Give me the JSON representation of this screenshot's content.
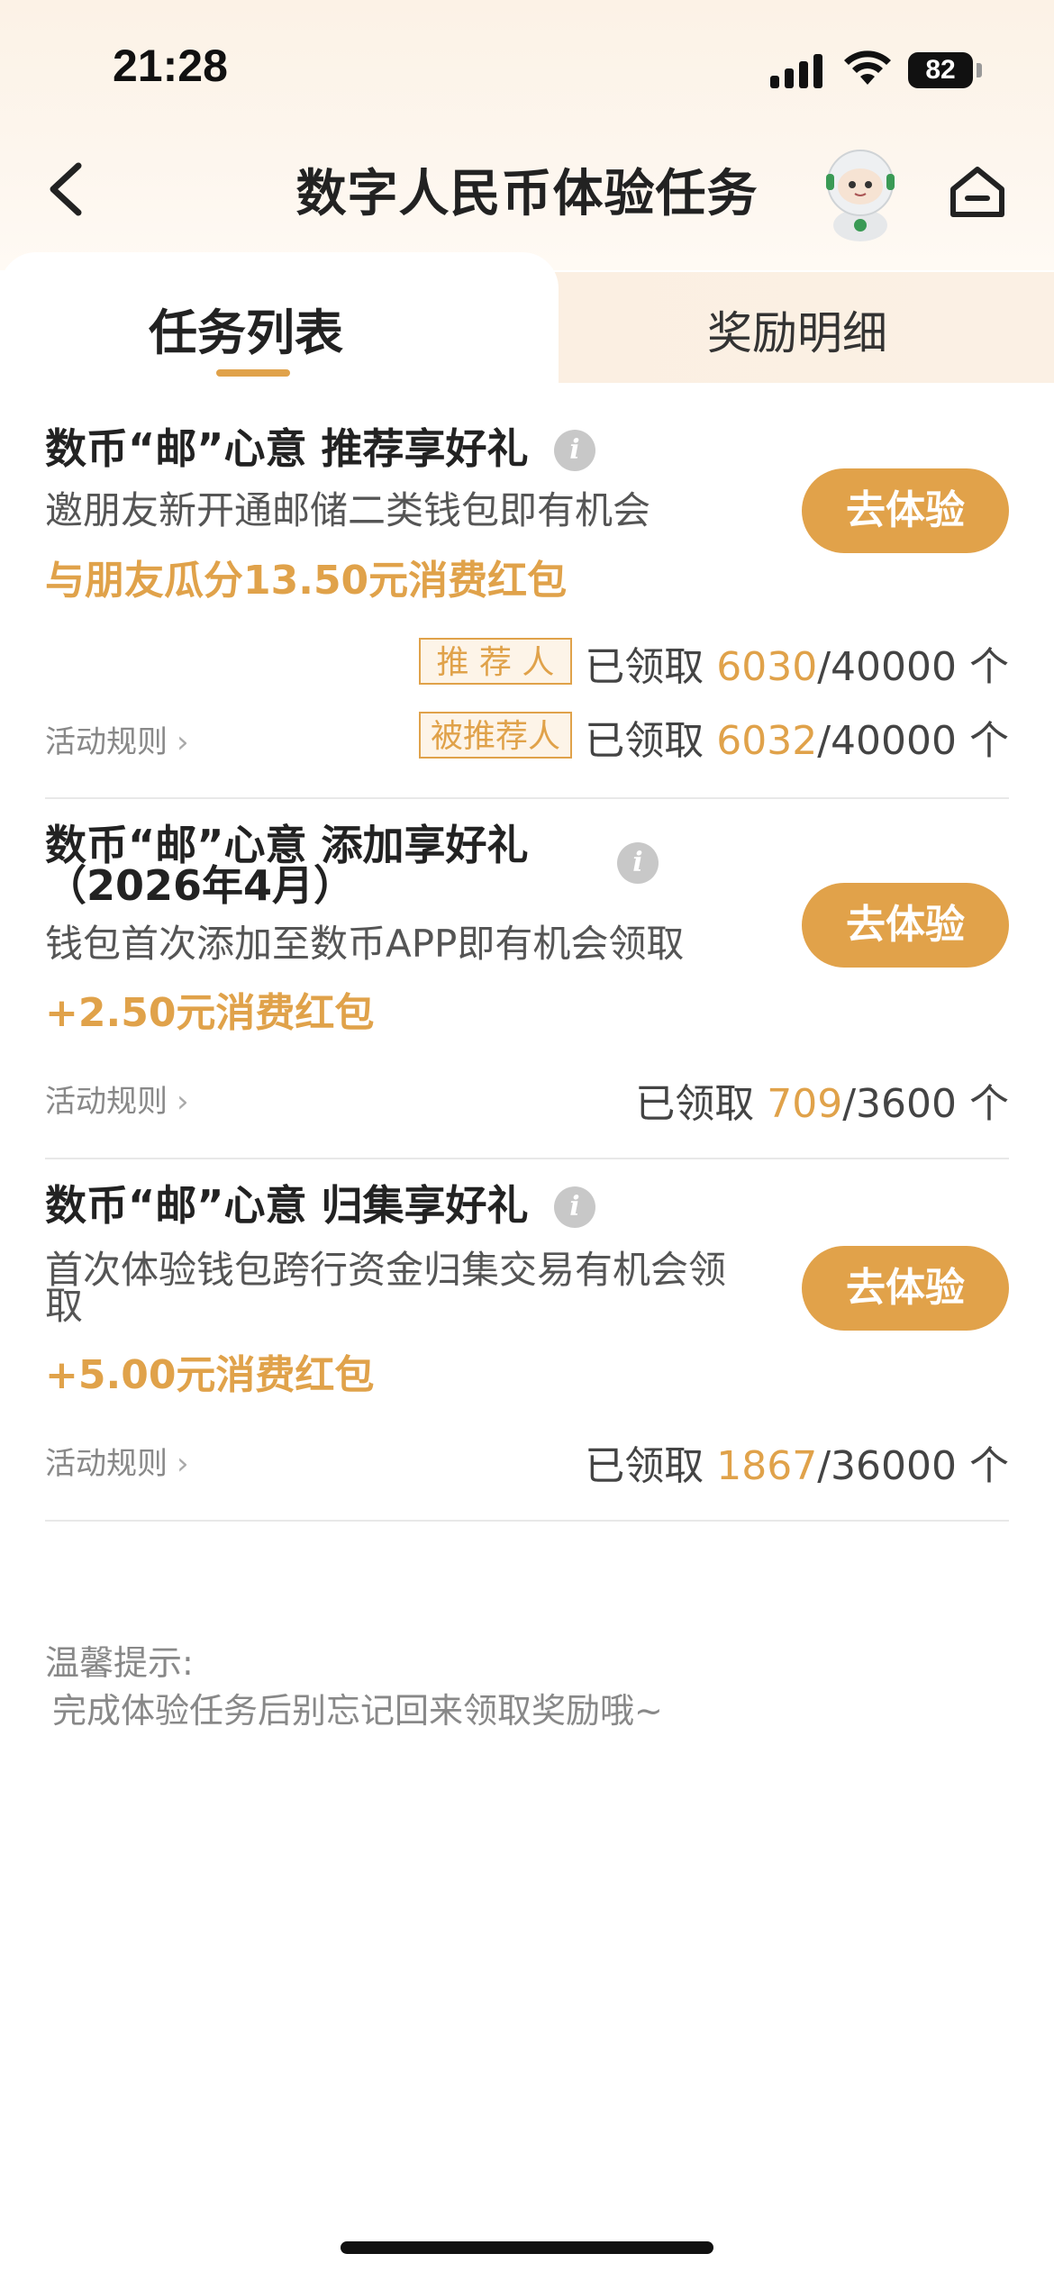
{
  "status_bar": {
    "time": "21:28",
    "battery": "82"
  },
  "nav": {
    "title": "数字人民币体验任务"
  },
  "tabs": [
    {
      "label": "任务列表",
      "active": true
    },
    {
      "label": "奖励明细",
      "active": false
    }
  ],
  "tasks": [
    {
      "title": "数币“邮”心意 推荐享好礼",
      "description": "邀朋友新开通邮储二类钱包即有机会",
      "reward": "与朋友瓜分13.50元消费红包",
      "button": "去体验",
      "rules": "活动规则",
      "claims": [
        {
          "tag": "推 荐 人",
          "prefix": "已领取 ",
          "claimed": "6030",
          "total": "/40000 个"
        },
        {
          "tag": "被推荐人",
          "prefix": "已领取 ",
          "claimed": "6032",
          "total": "/40000 个"
        }
      ]
    },
    {
      "title": "数币“邮”心意 添加享好礼",
      "title_line2": "（2026年4月）",
      "description": "钱包首次添加至数币APP即有机会领取",
      "reward": "+2.50元消费红包",
      "button": "去体验",
      "rules": "活动规则",
      "claims": [
        {
          "prefix": "已领取 ",
          "claimed": "709",
          "total": "/3600 个"
        }
      ]
    },
    {
      "title": "数币“邮”心意 归集享好礼",
      "description": "首次体验钱包跨行资金归集交易有机会领",
      "description_line2": "取",
      "reward": "+5.00元消费红包",
      "button": "去体验",
      "rules": "活动规则",
      "claims": [
        {
          "prefix": "已领取 ",
          "claimed": "1867",
          "total": "/36000 个"
        }
      ]
    }
  ],
  "tips": {
    "title": "温馨提示:",
    "text": "完成体验任务后别忘记回来领取奖励哦~"
  },
  "colors": {
    "accent": "#e0a24a",
    "button": "#e1a24a"
  }
}
